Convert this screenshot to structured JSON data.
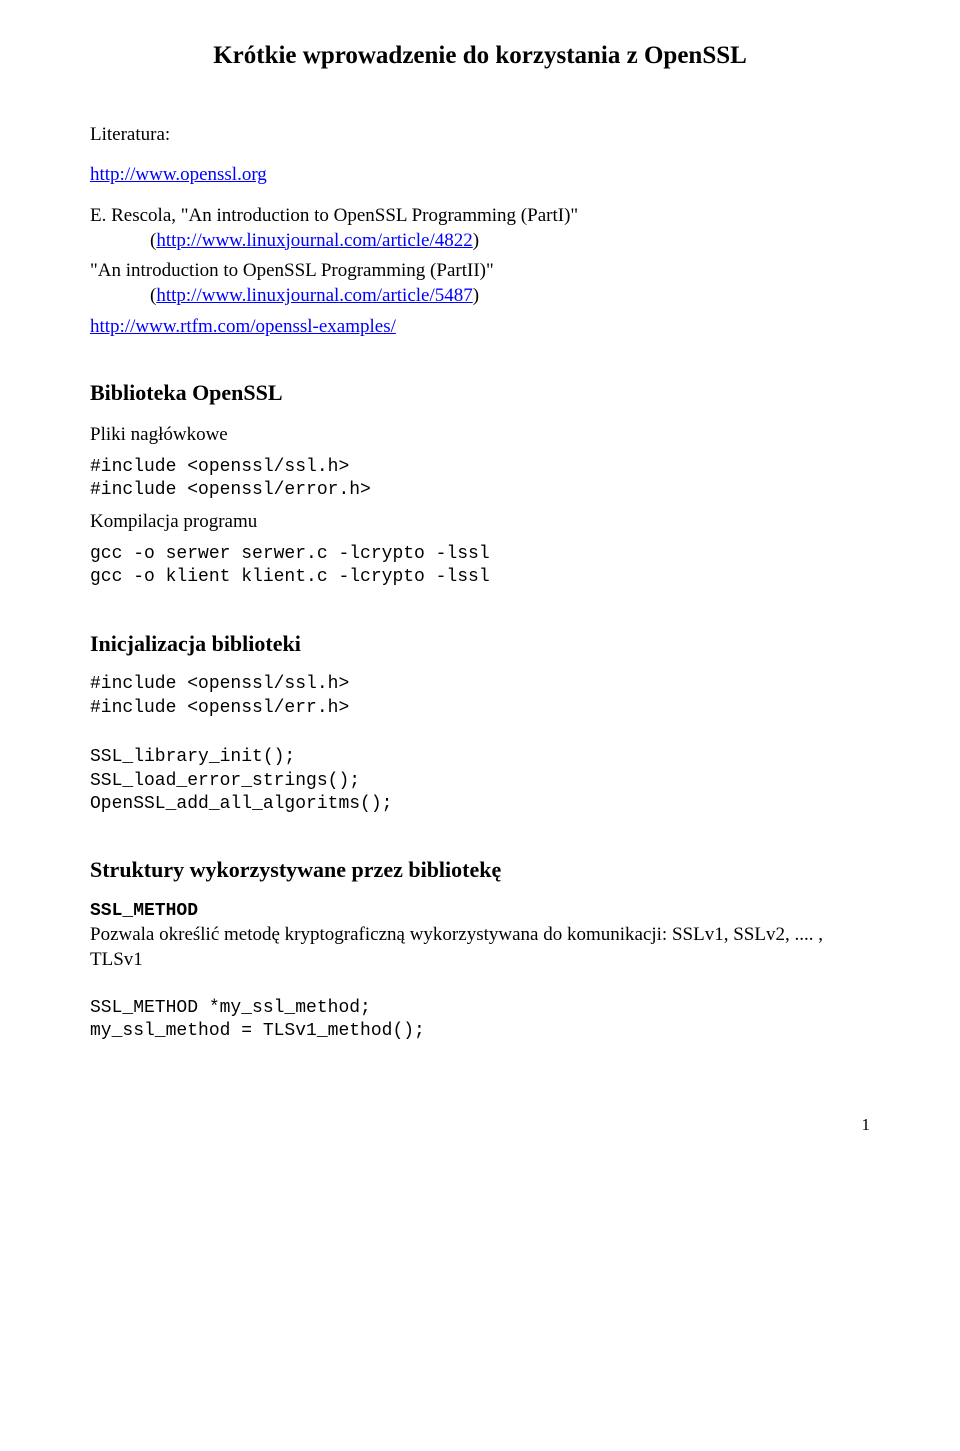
{
  "title": "Krótkie wprowadzenie do korzystania z OpenSSL",
  "literature": {
    "heading": "Literatura:",
    "link1": "http://www.openssl.org",
    "entry2": {
      "prefix": "E. Rescola, \"An introduction to OpenSSL Programming (PartI)\"",
      "pre_link": "(",
      "link": "http://www.linuxjournal.com/article/4822",
      "post_link": ")"
    },
    "entry3": {
      "prefix": "\"An introduction to OpenSSL Programming (PartII)\"",
      "pre_link": "(",
      "link": "http://www.linuxjournal.com/article/5487",
      "post_link": ")"
    },
    "link4": "http://www.rtfm.com/openssl-examples/"
  },
  "section1": {
    "heading": "Biblioteka OpenSSL",
    "sub1": "Pliki nagłówkowe",
    "code1": "#include <openssl/ssl.h>\n#include <openssl/error.h>",
    "sub2": "Kompilacja programu",
    "code2": "gcc -o serwer serwer.c -lcrypto -lssl\ngcc -o klient klient.c -lcrypto -lssl"
  },
  "section2": {
    "heading": "Inicjalizacja biblioteki",
    "code1": "#include <openssl/ssl.h>\n#include <openssl/err.h>",
    "code2": "SSL_library_init();\nSSL_load_error_strings();\nOpenSSL_add_all_algoritms();"
  },
  "section3": {
    "heading": "Struktury wykorzystywane przez bibliotekę",
    "struct_name": "SSL_METHOD",
    "desc": "Pozwala określić metodę kryptograficzną wykorzystywana do komunikacji: SSLv1, SSLv2, .... , TLSv1",
    "code": "SSL_METHOD *my_ssl_method;\nmy_ssl_method = TLSv1_method();"
  },
  "page_number": "1"
}
